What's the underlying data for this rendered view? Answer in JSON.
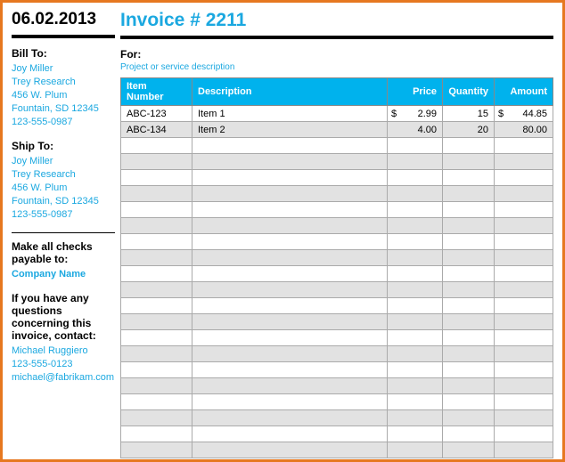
{
  "date": "06.02.2013",
  "invoice_title": "Invoice # 2211",
  "for_label": "For:",
  "project_desc": "Project or service description",
  "bill_to": {
    "heading": "Bill To:",
    "name": "Joy Miller",
    "company": "Trey Research",
    "street": "456 W. Plum",
    "city": "Fountain, SD 12345",
    "phone": "123-555-0987"
  },
  "ship_to": {
    "heading": "Ship To:",
    "name": "Joy Miller",
    "company": "Trey Research",
    "street": "456 W. Plum",
    "city": "Fountain, SD 12345",
    "phone": "123-555-0987"
  },
  "payable": {
    "heading": "Make all checks payable to:",
    "company": "Company Name"
  },
  "contact": {
    "heading": "If you have any questions concerning this invoice, contact:",
    "name": "Michael Ruggiero",
    "phone": "123-555-0123",
    "email": "michael@fabrikam.com"
  },
  "columns": {
    "item_number": "Item Number",
    "description": "Description",
    "price": "Price",
    "quantity": "Quantity",
    "amount": "Amount"
  },
  "currency": "$",
  "rows": [
    {
      "item_number": "ABC-123",
      "description": "Item 1",
      "price": "2.99",
      "quantity": "15",
      "amount": "44.85",
      "show_currency": true
    },
    {
      "item_number": "ABC-134",
      "description": "Item 2",
      "price": "4.00",
      "quantity": "20",
      "amount": "80.00",
      "show_currency": false
    }
  ],
  "blank_rows": 20
}
